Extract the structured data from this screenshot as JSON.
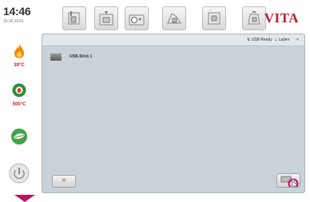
{
  "header": {
    "time": "14:46",
    "date": "26.06.2016",
    "brand": "VITA",
    "tools": [
      "tool-1-icon",
      "tool-2-icon",
      "tool-3-icon",
      "tool-4-icon",
      "tool-5-icon",
      "tool-6-icon"
    ]
  },
  "sidebar": {
    "items": [
      {
        "icon": "flame-icon",
        "label": "39°C"
      },
      {
        "icon": "heating-ring-icon",
        "label": "500°C"
      },
      {
        "icon": "leaf-icon",
        "label": ""
      },
      {
        "icon": "power-icon",
        "label": ""
      }
    ]
  },
  "panel": {
    "usb_ready": "USB Ready",
    "load": "Laden",
    "file": "USB-Stick 1"
  },
  "buttons": {
    "cancel_symbol": "×"
  },
  "colors": {
    "brand": "#c01e2f",
    "panel": "#c8d2d8",
    "accent": "#c01060"
  }
}
